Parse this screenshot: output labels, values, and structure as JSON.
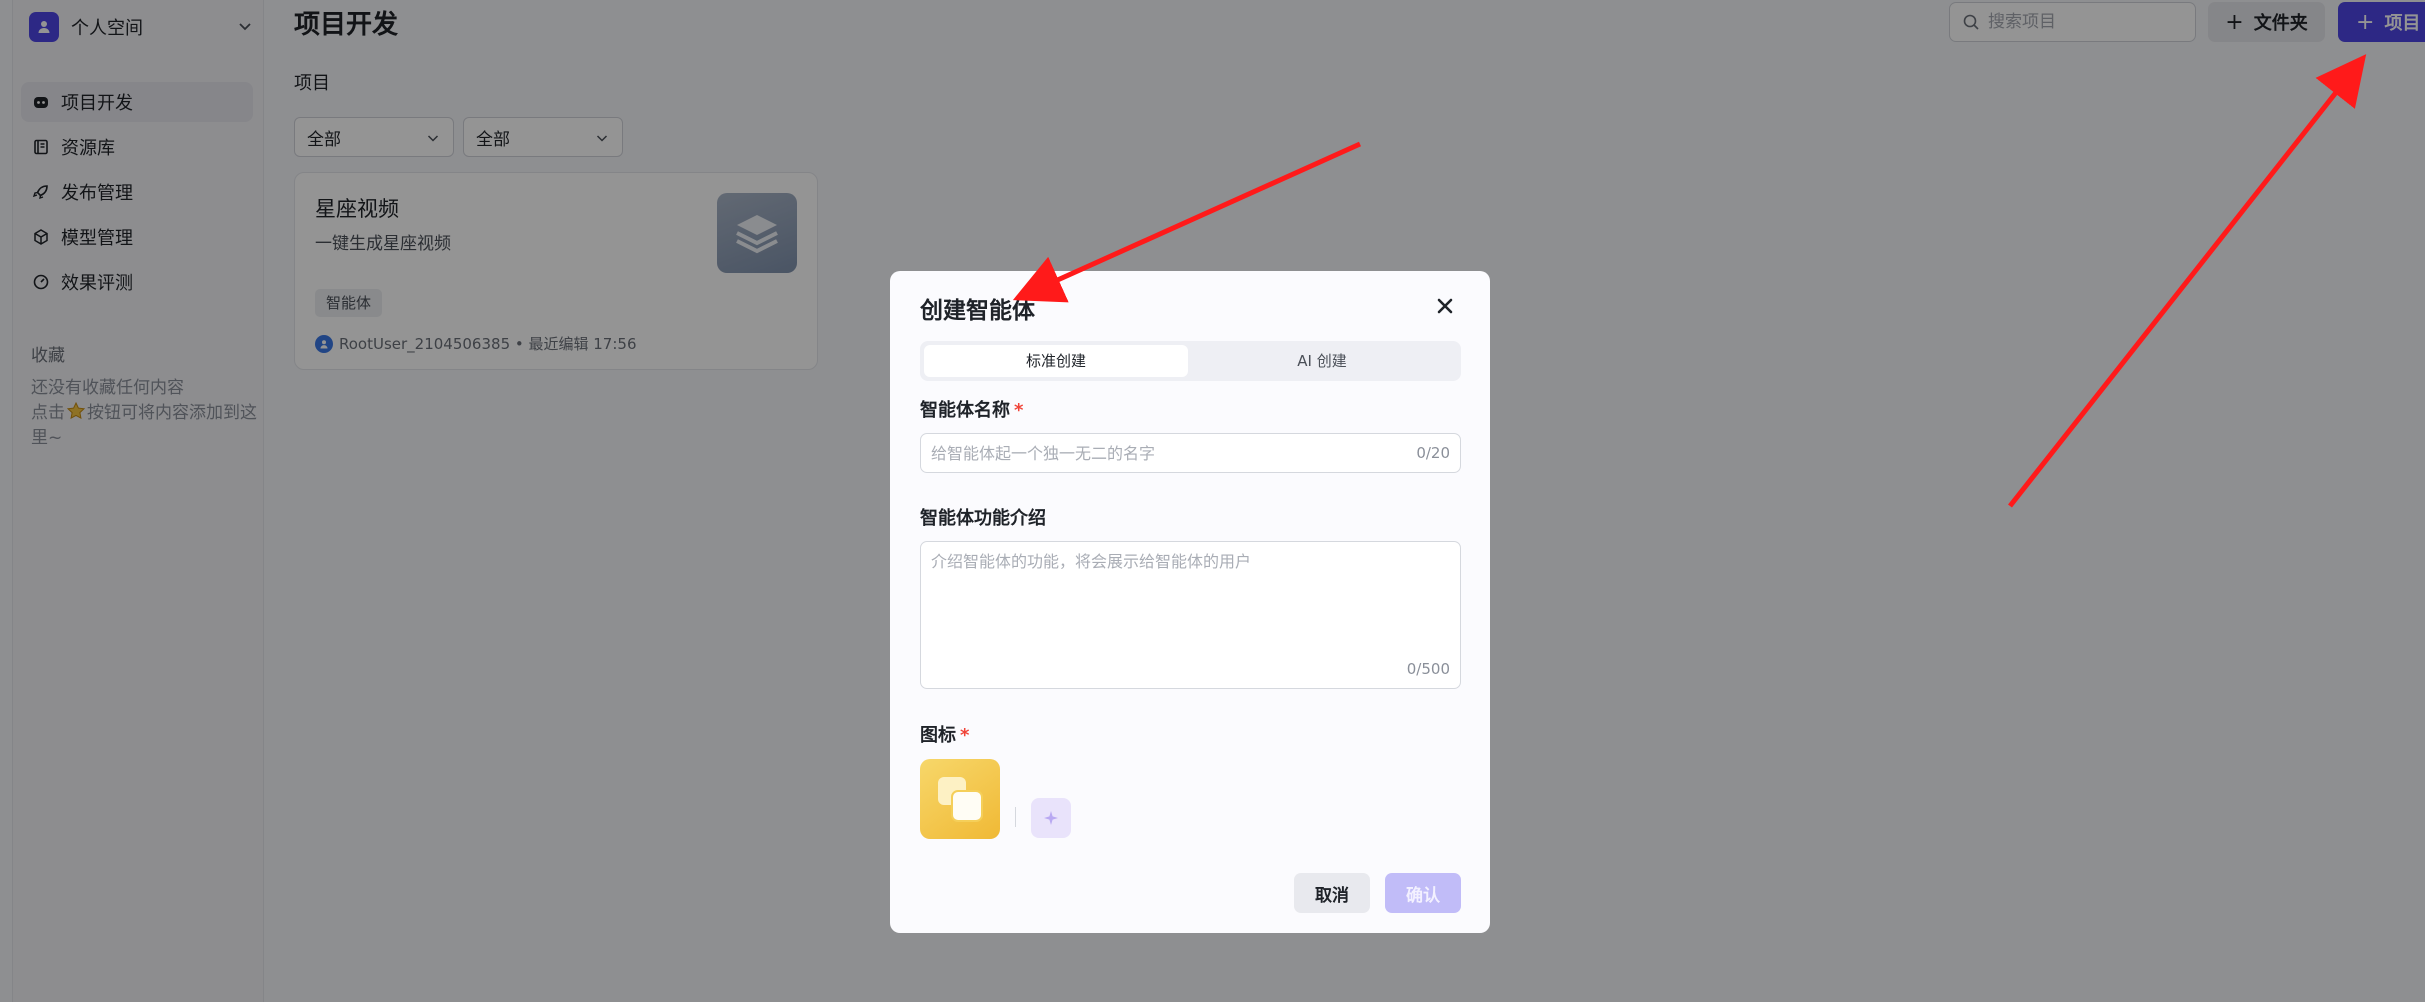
{
  "sidebar": {
    "space_name": "个人空间",
    "nav": [
      {
        "label": "项目开发",
        "icon": "bot-icon",
        "active": true
      },
      {
        "label": "资源库",
        "icon": "library-icon"
      },
      {
        "label": "发布管理",
        "icon": "rocket-icon"
      },
      {
        "label": "模型管理",
        "icon": "cube-icon"
      },
      {
        "label": "效果评测",
        "icon": "gauge-icon"
      }
    ],
    "favorites": {
      "title": "收藏",
      "empty_line1": "还没有收藏任何内容",
      "empty_prefix": "点击",
      "empty_suffix": "按钮可将内容添加到这里~"
    }
  },
  "main": {
    "title": "项目开发",
    "section_label": "项目",
    "filters": [
      "全部",
      "全部"
    ],
    "search_placeholder": "搜索项目",
    "folder_button": "文件夹",
    "project_button": "项目",
    "project_card": {
      "title": "星座视频",
      "description": "一键生成星座视频",
      "badge": "智能体",
      "meta": "RootUser_2104506385 • 最近编辑 17:56"
    }
  },
  "modal": {
    "title": "创建智能体",
    "tabs": [
      "标准创建",
      "AI 创建"
    ],
    "name_label": "智能体名称",
    "name_placeholder": "给智能体起一个独一无二的名字",
    "name_counter": "0/20",
    "desc_label": "智能体功能介绍",
    "desc_placeholder": "介绍智能体的功能，将会展示给智能体的用户",
    "desc_counter": "0/500",
    "icon_label": "图标",
    "cancel_label": "取消",
    "confirm_label": "确认"
  },
  "colors": {
    "brand": "#4e45e6",
    "required": "#f04438",
    "annotation_arrow": "#ff1a1a"
  }
}
